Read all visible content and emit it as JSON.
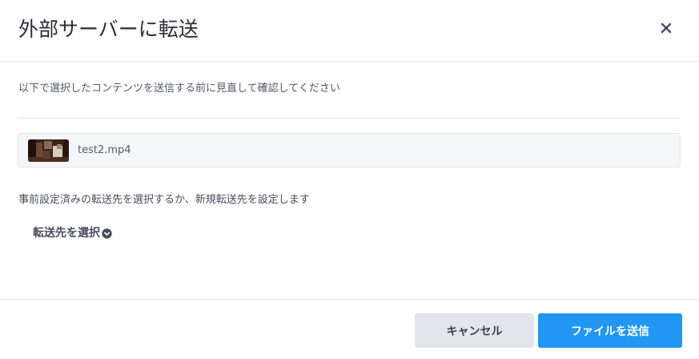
{
  "dialog": {
    "title": "外部サーバーに転送",
    "close_icon": "close-icon"
  },
  "intro_text": "以下で選択したコンテンツを送信する前に見直して確認してください",
  "file": {
    "name": "test2.mp4",
    "thumbnail_icon": "video-thumbnail"
  },
  "destination": {
    "description": "事前設定済みの転送先を選択するか、新規転送先を設定します",
    "select_label": "転送先を選択",
    "select_icon": "chevron-down-circle-icon"
  },
  "footer": {
    "cancel_label": "キャンセル",
    "send_label": "ファイルを送信"
  },
  "colors": {
    "primary": "#2196f3",
    "secondary_button": "#e4e5ec",
    "file_row_bg": "#f5f6fa"
  }
}
